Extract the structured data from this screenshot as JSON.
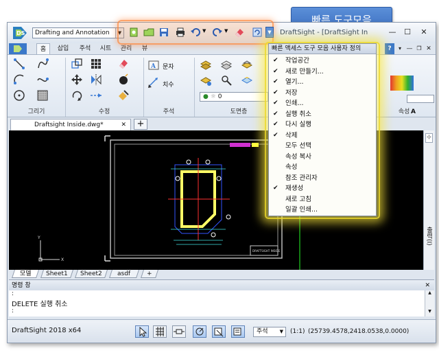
{
  "callout": {
    "text": "빠른 도구모음"
  },
  "titlebar": {
    "workspace": "Drafting and Annotation",
    "app_title": "DraftSight - [DraftSight In",
    "minimize": "—",
    "maximize": "☐",
    "close": "✕"
  },
  "ribbon": {
    "tabs": [
      {
        "label": "홈"
      },
      {
        "label": "삽입"
      },
      {
        "label": "주석"
      },
      {
        "label": "시트"
      },
      {
        "label": "관리"
      },
      {
        "label": "뷰"
      }
    ],
    "help": "?",
    "groups": [
      {
        "label": "그리기"
      },
      {
        "label": "수정"
      },
      {
        "label": "주석"
      },
      {
        "label": "도면층"
      },
      {
        "label": "속성"
      }
    ],
    "text_button": "문자",
    "dim_button": "치수",
    "layer_value": "0"
  },
  "quick_menu": {
    "header": "빠른 액세스 도구 모음 사용자 정의",
    "items": [
      {
        "label": "작업공간",
        "checked": true
      },
      {
        "label": "새로 만들기...",
        "checked": true
      },
      {
        "label": "열기...",
        "checked": true
      },
      {
        "label": "저장",
        "checked": true
      },
      {
        "label": "인쇄...",
        "checked": true
      },
      {
        "label": "실행 취소",
        "checked": true
      },
      {
        "label": "다시 실행",
        "checked": true
      },
      {
        "label": "삭제",
        "checked": true
      },
      {
        "label": "모두 선택",
        "checked": false
      },
      {
        "label": "속성 복사",
        "checked": false
      },
      {
        "label": "속성",
        "checked": false
      },
      {
        "label": "참조 관리자",
        "checked": false
      },
      {
        "label": "재생성",
        "checked": true
      },
      {
        "label": "새로 고침",
        "checked": false
      },
      {
        "label": "일괄 인쇄...",
        "checked": false
      }
    ]
  },
  "document": {
    "tab_title": "Draftsight Inside.dwg*",
    "close": "✕",
    "new_tab": "+",
    "title_block_text": "DRAFTSIGHT INSIDE",
    "axis_x": "X",
    "axis_y": "Y"
  },
  "layout_tabs": [
    {
      "label": "모델",
      "active": true
    },
    {
      "label": "Sheet1",
      "active": false
    },
    {
      "label": "Sheet2",
      "active": false
    },
    {
      "label": "asdf",
      "active": false
    },
    {
      "label": "+",
      "active": false
    }
  ],
  "side_panel": {
    "label": "출력(I)"
  },
  "command": {
    "title": "명령 창",
    "line1": ":",
    "line2": "DELETE 실행 취소",
    "line3": ":"
  },
  "status": {
    "version": "DraftSight 2018 x64",
    "annotation": "주석",
    "scale": "(1:1)",
    "coords": "(25739.4578,2418.0538,0.0000)"
  },
  "colors": {
    "accent_blue": "#3a6dbf",
    "menu_glow": "#f5e23c",
    "toolbar_highlight": "#ff8c3c",
    "canvas": "#000000"
  }
}
